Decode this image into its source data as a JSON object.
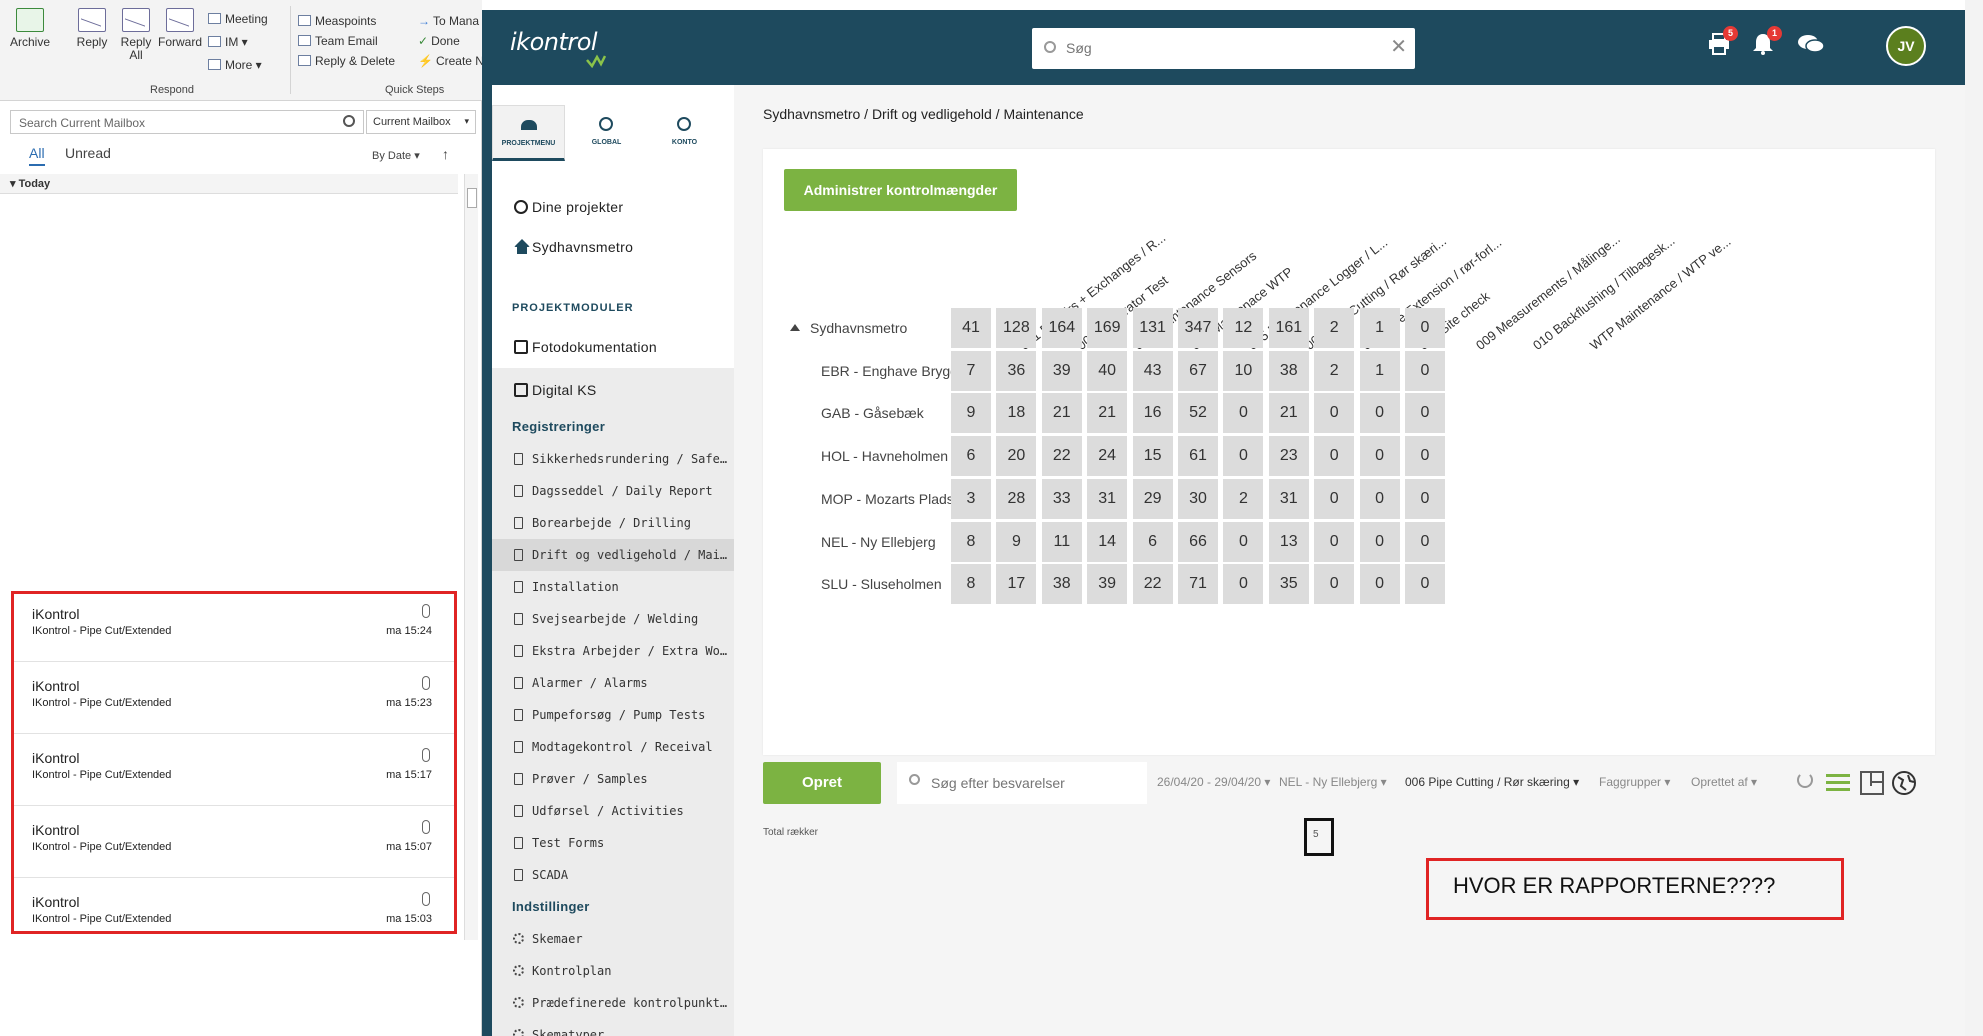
{
  "outlook": {
    "ribbon": {
      "archive": "Archive",
      "reply": "Reply",
      "reply_all_1": "Reply",
      "reply_all_2": "All",
      "forward": "Forward",
      "meeting": "Meeting",
      "im": "IM",
      "more": "More",
      "respond_group": "Respond",
      "quick_steps": [
        "Measpoints",
        "Team Email",
        "Reply & Delete"
      ],
      "quick_steps_2": [
        "To Mana",
        "Done",
        "Create N"
      ],
      "quick_steps_group": "Quick Steps"
    },
    "search_placeholder": "Search Current Mailbox",
    "scope": "Current Mailbox",
    "filters": {
      "all": "All",
      "unread": "Unread",
      "sort": "By Date",
      "sort_arrow": "↑"
    },
    "group_today": "Today",
    "mails": [
      {
        "from": "iKontrol",
        "subject": "IKontrol - Pipe Cut/Extended",
        "time": "ma 15:24"
      },
      {
        "from": "iKontrol",
        "subject": "IKontrol - Pipe Cut/Extended",
        "time": "ma 15:23"
      },
      {
        "from": "iKontrol",
        "subject": "IKontrol - Pipe Cut/Extended",
        "time": "ma 15:17"
      },
      {
        "from": "iKontrol",
        "subject": "IKontrol - Pipe Cut/Extended",
        "time": "ma 15:07"
      },
      {
        "from": "iKontrol",
        "subject": "IKontrol - Pipe Cut/Extended",
        "time": "ma 15:03"
      }
    ]
  },
  "app": {
    "logo": "ikontrol",
    "search_placeholder": "Søg",
    "badges": {
      "printer": "5",
      "bell": "1"
    },
    "avatar": "JV",
    "sidebar": {
      "tabs": [
        "PROJEKTMENU",
        "GLOBAL",
        "KONTO"
      ],
      "nav": [
        "Dine projekter",
        "Sydhavnsmetro"
      ],
      "modules_heading": "PROJEKTMODULER",
      "fotodok": "Fotodokumentation",
      "digital_ks": "Digital KS",
      "registreringer": "Registreringer",
      "items": [
        "Sikkerhedsrundering / Safety",
        "Dagsseddel / Daily Report",
        "Borearbejde / Drilling",
        "Drift og vedligehold / Maintenance",
        "Installation",
        "Svejsearbejde / Welding",
        "Ekstra Arbejder / Extra Works",
        "Alarmer / Alarms",
        "Pumpeforsøg / Pump Tests",
        "Modtagekontrol / Receival",
        "Prøver / Samples",
        "Udførsel / Activities",
        "Test Forms",
        "SCADA"
      ],
      "indstillinger": "Indstillinger",
      "settings": [
        "Skemaer",
        "Kontrolplan",
        "Prædefinerede kontrolpunkter",
        "Skematyper"
      ]
    },
    "breadcrumb": "Sydhavnsmetro / Drift og vedligehold / Maintenance",
    "manage_button": "Administrer kontrolmængder",
    "columns": [
      "001 Repairs + Exchanges / R...",
      "002 Generator Test",
      "003 Maintenance Sensors",
      "004 Maintenace WTP",
      "005 Maintenance Logger / L...",
      "006 Pipe Cutting / Rør skæri...",
      "007 Pipe Extension / rør-forl...",
      "008 Site check",
      "009 Measurements / Målinge...",
      "010 Backflushing / Tilbagesk...",
      "WTP Maintenance / WTP ve..."
    ],
    "rows": [
      {
        "label": "Sydhavnsmetro",
        "values": [
          "41",
          "128",
          "164",
          "169",
          "131",
          "347",
          "12",
          "161",
          "2",
          "1",
          "0"
        ]
      },
      {
        "label": "EBR - Enghave Brygge",
        "values": [
          "7",
          "36",
          "39",
          "40",
          "43",
          "67",
          "10",
          "38",
          "2",
          "1",
          "0"
        ]
      },
      {
        "label": "GAB - Gåsebæk",
        "values": [
          "9",
          "18",
          "21",
          "21",
          "16",
          "52",
          "0",
          "21",
          "0",
          "0",
          "0"
        ]
      },
      {
        "label": "HOL - Havneholmen",
        "values": [
          "6",
          "20",
          "22",
          "24",
          "15",
          "61",
          "0",
          "23",
          "0",
          "0",
          "0"
        ]
      },
      {
        "label": "MOP - Mozarts Plads",
        "values": [
          "3",
          "28",
          "33",
          "31",
          "29",
          "30",
          "2",
          "31",
          "0",
          "0",
          "0"
        ]
      },
      {
        "label": "NEL - Ny Ellebjerg",
        "values": [
          "8",
          "9",
          "11",
          "14",
          "6",
          "66",
          "0",
          "13",
          "0",
          "0",
          "0"
        ]
      },
      {
        "label": "SLU - Sluseholmen",
        "values": [
          "8",
          "17",
          "38",
          "39",
          "22",
          "71",
          "0",
          "35",
          "0",
          "0",
          "0"
        ]
      }
    ],
    "toolbar": {
      "create": "Opret",
      "search_placeholder": "Søg efter besvarelser",
      "date_range": "26/04/20 - 29/04/20",
      "location": "NEL - Ny Ellebjerg",
      "form": "006 Pipe Cutting / Rør skæring",
      "faggrupper": "Faggrupper",
      "oprettet_af": "Oprettet af"
    },
    "total_label": "Total rækker",
    "total_value": "5",
    "annotation": "HVOR ER RAPPORTERNE????"
  }
}
